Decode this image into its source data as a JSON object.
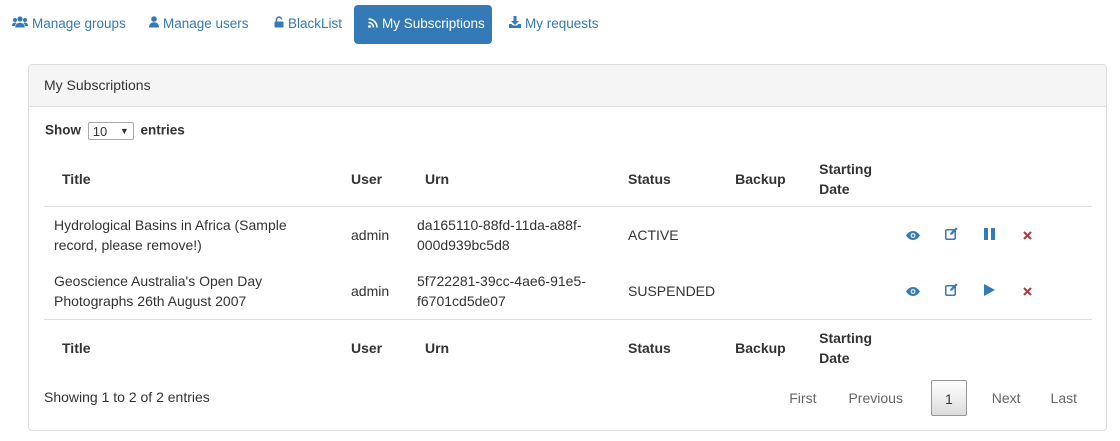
{
  "tabs": [
    {
      "label": "Manage groups",
      "icon": "users-icon"
    },
    {
      "label": "Manage users",
      "icon": "user-icon"
    },
    {
      "label": "BlackList",
      "icon": "lock-icon"
    },
    {
      "label": "My Subscriptions",
      "icon": "rss-icon",
      "active": true
    },
    {
      "label": "My requests",
      "icon": "download-icon"
    }
  ],
  "panel": {
    "title": "My Subscriptions"
  },
  "length": {
    "show": "Show",
    "value": "10",
    "entries": "entries"
  },
  "columns": {
    "title": "Title",
    "user": "User",
    "urn": "Urn",
    "status": "Status",
    "backup": "Backup",
    "start_date": "Starting Date"
  },
  "rows": [
    {
      "title": "Hydrological Basins in Africa (Sample record, please remove!)",
      "user": "admin",
      "urn": "da165110-88fd-11da-a88f-000d939bc5d8",
      "status": "ACTIVE",
      "backup": "",
      "start_date": "",
      "actions": [
        "eye-icon",
        "edit-icon",
        "pause-icon",
        "delete-icon"
      ]
    },
    {
      "title": "Geoscience Australia's Open Day Photographs 26th August 2007",
      "user": "admin",
      "urn": "5f722281-39cc-4ae6-91e5-f6701cd5de07",
      "status": "SUSPENDED",
      "backup": "",
      "start_date": "",
      "actions": [
        "eye-icon",
        "edit-icon",
        "play-icon",
        "delete-icon"
      ]
    }
  ],
  "info": "Showing 1 to 2 of 2 entries",
  "pager": {
    "first": "First",
    "previous": "Previous",
    "current": "1",
    "next": "Next",
    "last": "Last"
  },
  "colors": {
    "accent": "#337ab7",
    "delete": "#a94442",
    "panel_head": "#f5f5f5"
  }
}
